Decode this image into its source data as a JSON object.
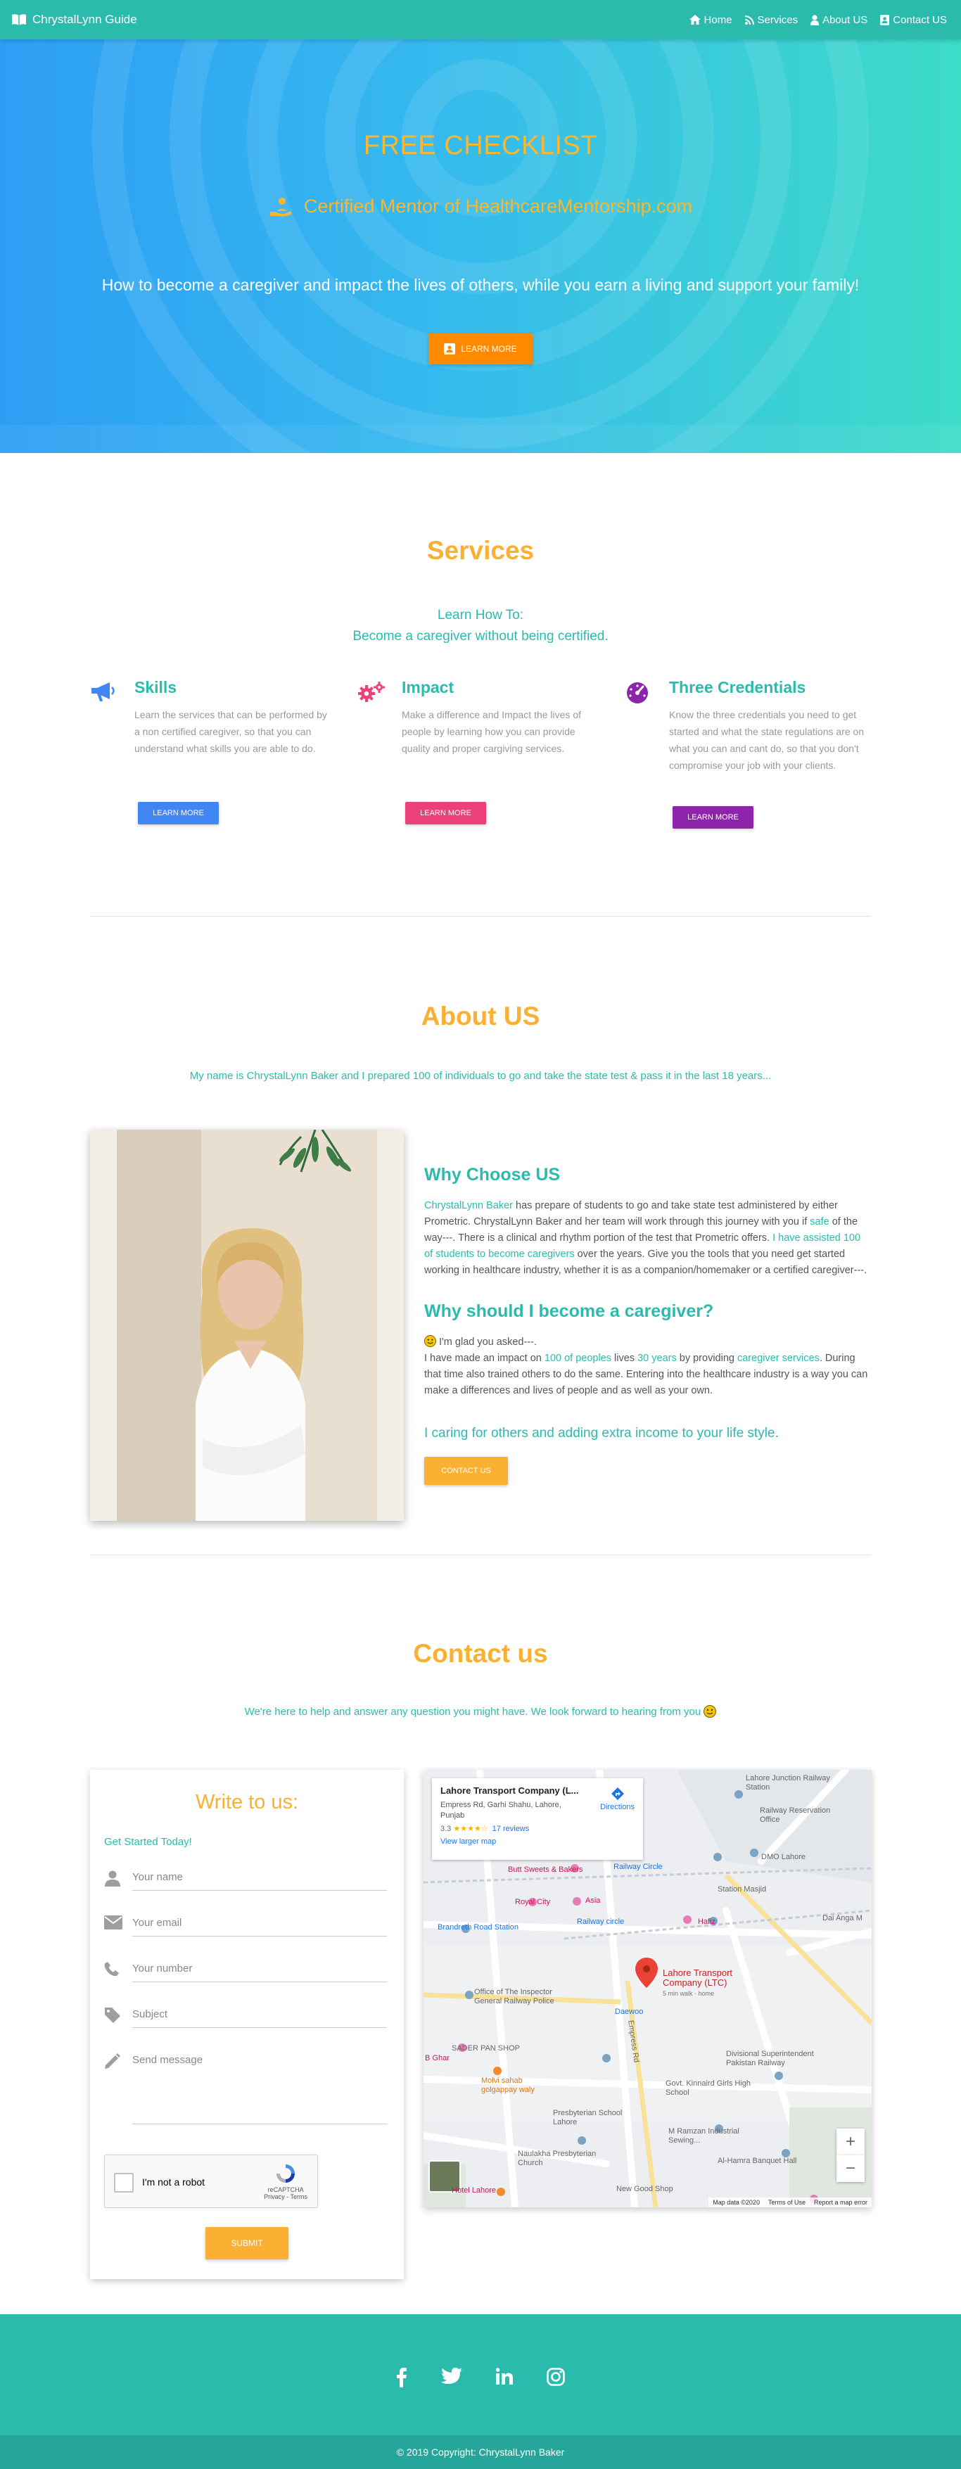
{
  "nav": {
    "brand": "ChrystalLynn Guide",
    "links": [
      {
        "label": "Home",
        "icon": "home-icon"
      },
      {
        "label": "Services",
        "icon": "rss-icon"
      },
      {
        "label": "About US",
        "icon": "user-icon"
      },
      {
        "label": "Contact US",
        "icon": "contact-card-icon"
      }
    ]
  },
  "hero": {
    "title": "FREE CHECKLIST",
    "subtitle": "Certified Mentor of HealthcareMentorship.com",
    "description": "How to become a caregiver and impact the lives of others, while you earn a living and support your family!",
    "button": "LEARN MORE"
  },
  "services": {
    "title": "Services",
    "intro_line1": "Learn How To:",
    "intro_line2": "Become a caregiver without being certified.",
    "items": [
      {
        "title": "Skills",
        "text": "Learn the services that can be performed by a non certified caregiver, so that you can understand what skills you are able to do.",
        "button": "LEARN MORE",
        "color": "#4285f4",
        "icon": "megaphone-icon"
      },
      {
        "title": "Impact",
        "text": "Make a difference and Impact the lives of people by learning how you can provide quality and proper cargiving services.",
        "button": "LEARN MORE",
        "color": "#ec407a",
        "icon": "gears-icon"
      },
      {
        "title": "Three Credentials",
        "text": "Know the three credentials you need to get started and what the state regulations are on what you can and cant do, so that you don't compromise your job with your clients.",
        "button": "LEARN MORE",
        "color": "#8e24aa",
        "icon": "speedometer-icon"
      }
    ]
  },
  "about": {
    "title": "About US",
    "lead": "My name is ChrystalLynn Baker and I prepared 100 of individuals to go and take the state test & pass it in the last 18 years...",
    "why_title": "Why Choose US",
    "why_p1_name": "ChrystalLynn Baker",
    "why_p1_a": " has prepare of students to go and take state test administered by either Prometric. ChrystalLynn Baker and her team will work through this journey with you if ",
    "why_p1_safe": "safe",
    "why_p1_b": " of the way---. There is a clinical and rhythm portion of the test that Prometric offers. ",
    "why_p1_assisted": "I have assisted 100 of students to become caregivers",
    "why_p1_c": " over the years. Give you the tools that you need get started working in healthcare industry, whether it is as a companion/homemaker or a certified caregiver---.",
    "should_title": "Why should I become a caregiver?",
    "should_p1": "I'm glad you asked---.",
    "should_p2_a": "I have made an impact on ",
    "should_p2_peoples": "100 of peoples",
    "should_p2_b": " lives ",
    "should_p2_years": "30 years",
    "should_p2_c": " by providing ",
    "should_p2_services": "caregiver services",
    "should_p2_d": ". During that time also trained others to do the same. Entering into the healthcare industry is a way you can make a differences and lives of people and as well as your own.",
    "closing": "I caring for others and adding extra income to your life style.",
    "button": "CONTACT US"
  },
  "contact": {
    "title": "Contact us",
    "lead": "We're here to help and answer any question you might have. We look forward to hearing from you",
    "form_title": "Write to us:",
    "get_started": "Get Started Today!",
    "fields": {
      "name": "Your name",
      "email": "Your email",
      "number": "Your number",
      "subject": "Subject",
      "message": "Send message"
    },
    "captcha_label": "I'm not a robot",
    "captcha_brand": "reCAPTCHA",
    "captcha_terms": "Privacy - Terms",
    "submit": "SUBMIT"
  },
  "map": {
    "place": "Lahore Transport Company (L...",
    "address": "Empress Rd, Garhi Shahu, Lahore, Punjab",
    "rating": "3.3",
    "stars": "★★★★☆",
    "reviews": "17 reviews",
    "larger_map": "View larger map",
    "directions": "Directions",
    "pin_label": "Lahore Transport Company (LTC)",
    "pin_sub": "5 min walk · home",
    "labels": {
      "junction": "Lahore Junction Railway Station",
      "reservation": "Railway Reservation Office",
      "dmo": "DMO Lahore",
      "butt": "Butt Sweets & Bakers",
      "royal": "Royal City",
      "asia": "Asia",
      "railway_circle": "Railway Circle",
      "station_masjid": "Station Masjid",
      "brandreth": "Brandreth Road Station",
      "railway_circle2": "Railway circle",
      "hafiz": "Hafiz",
      "dai_anga": "Dai Anga M",
      "inspector": "Office of The Inspector General Railway Police",
      "daewoo": "Daewoo",
      "sader": "SADER PAN SHOP",
      "divisional": "Divisional Superintendent Pakistan Railway",
      "ghar": "B Ghar",
      "molvi": "Molvi sahab golgappay waly",
      "kinnaird": "Govt. Kinnaird Girls High School",
      "presbyterian": "Presbyterian School Lahore",
      "ramzan": "M Ramzan Industrial Sewing...",
      "naulakha": "Naulakha Presbyterian Church",
      "alhamra": "Al-Hamra Banquet Hall",
      "newgood": "New Good Shop",
      "hotel": "Hotel Lahore",
      "empress": "Empress Rd"
    },
    "footer_data": "Map data ©2020",
    "footer_terms": "Terms of Use",
    "footer_report": "Report a map error"
  },
  "footer": {
    "socials": [
      "facebook-icon",
      "twitter-icon",
      "linkedin-icon",
      "instagram-icon"
    ],
    "copyright": "© 2019 Copyright: ChrystalLynn Baker"
  }
}
